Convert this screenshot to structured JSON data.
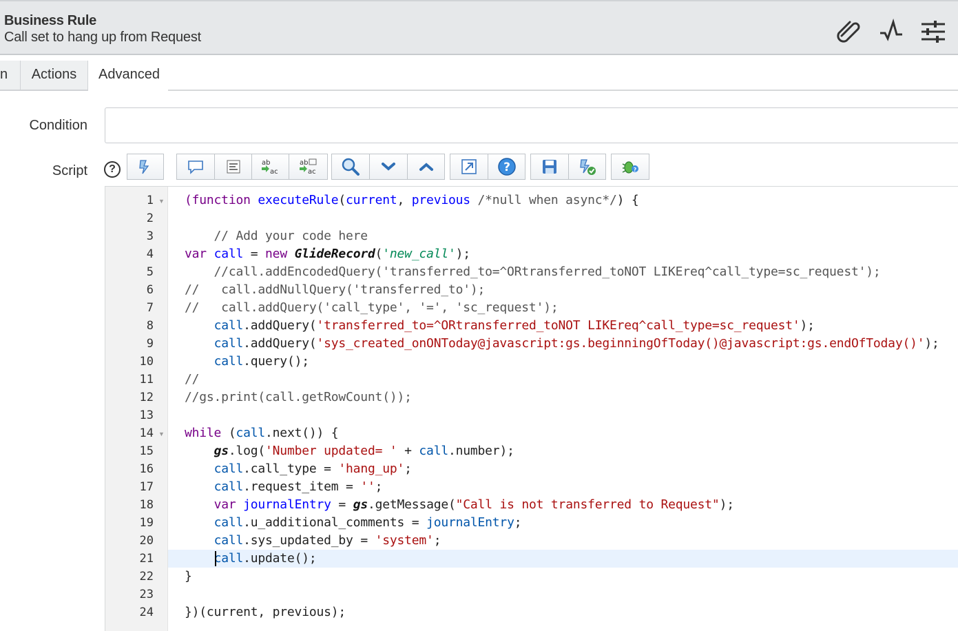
{
  "header": {
    "title": "Business Rule",
    "subtitle": "Call set to hang up from Request",
    "icons": [
      "paperclip-icon",
      "activity-icon",
      "settings-sliders-icon"
    ]
  },
  "tabs": [
    {
      "label": "n",
      "active": false
    },
    {
      "label": "Actions",
      "active": false
    },
    {
      "label": "Advanced",
      "active": true
    }
  ],
  "form": {
    "condition_label": "Condition",
    "condition_value": "",
    "script_label": "Script",
    "script_help": "?"
  },
  "toolbar": {
    "buttons": [
      "toggle-syntax-icon",
      "comment-icon",
      "format-code-icon",
      "replace-icon",
      "replace-all-icon",
      "search-icon",
      "find-next-icon",
      "find-previous-icon",
      "fullscreen-icon",
      "help-icon",
      "save-icon",
      "check-syntax-icon",
      "debug-icon"
    ]
  },
  "editor": {
    "line_numbers": [
      "1",
      "2",
      "3",
      "4",
      "5",
      "6",
      "7",
      "8",
      "9",
      "10",
      "11",
      "12",
      "13",
      "14",
      "15",
      "16",
      "17",
      "18",
      "19",
      "20",
      "21",
      "22",
      "23",
      "24"
    ],
    "code": {
      "l1_a": "(function",
      "l1_b": " ",
      "l1_c": "executeRule",
      "l1_d": "(",
      "l1_e": "current",
      "l1_f": ", ",
      "l1_g": "previous",
      "l1_h": " ",
      "l1_i": "/*null when async*/",
      "l1_j": ") {",
      "l3": "    // Add your code here",
      "l4_a": "var",
      "l4_b": " ",
      "l4_c": "call",
      "l4_d": " = ",
      "l4_e": "new",
      "l4_f": " ",
      "l4_g": "GlideRecord",
      "l4_h": "(",
      "l4_i": "'new_call'",
      "l4_j": ");",
      "l5": "    //call.addEncodedQuery('transferred_to=^ORtransferred_toNOT LIKEreq^call_type=sc_request');",
      "l6": "//   call.addNullQuery('transferred_to');",
      "l7": "//   call.addQuery('call_type', '=', 'sc_request');",
      "l8_a": "    ",
      "l8_b": "call",
      "l8_c": ".addQuery(",
      "l8_d": "'transferred_to=^ORtransferred_toNOT LIKEreq^call_type=sc_request'",
      "l8_e": ");",
      "l9_a": "    ",
      "l9_b": "call",
      "l9_c": ".addQuery(",
      "l9_d": "'sys_created_onONToday@javascript:gs.beginningOfToday()@javascript:gs.endOfToday()'",
      "l9_e": ");",
      "l10_a": "    ",
      "l10_b": "call",
      "l10_c": ".query();",
      "l11": "//",
      "l12": "//gs.print(call.getRowCount());",
      "l14_a": "while",
      "l14_b": " (",
      "l14_c": "call",
      "l14_d": ".next()) {",
      "l15_a": "    ",
      "l15_b": "gs",
      "l15_c": ".log(",
      "l15_d": "'Number updated= '",
      "l15_e": " + ",
      "l15_f": "call",
      "l15_g": ".number);",
      "l16_a": "    ",
      "l16_b": "call",
      "l16_c": ".call_type = ",
      "l16_d": "'hang_up'",
      "l16_e": ";",
      "l17_a": "    ",
      "l17_b": "call",
      "l17_c": ".request_item = ",
      "l17_d": "''",
      "l17_e": ";",
      "l18_a": "    ",
      "l18_b": "var",
      "l18_c": " ",
      "l18_d": "journalEntry",
      "l18_e": " = ",
      "l18_f": "gs",
      "l18_g": ".getMessage(",
      "l18_h": "\"Call is not transferred to Request\"",
      "l18_i": ");",
      "l19_a": "    ",
      "l19_b": "call",
      "l19_c": ".u_additional_comments = ",
      "l19_d": "journalEntry",
      "l19_e": ";",
      "l20_a": "    ",
      "l20_b": "call",
      "l20_c": ".sys_updated_by = ",
      "l20_d": "'system'",
      "l20_e": ";",
      "l21_a": "    ",
      "l21_b": "call",
      "l21_c": ".update();",
      "l22": "}",
      "l24": "})(current, previous);"
    }
  }
}
